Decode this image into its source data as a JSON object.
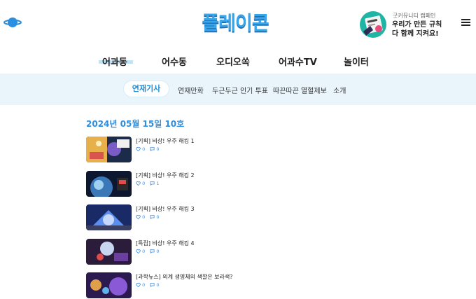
{
  "header": {
    "logo_text": "플레이콘",
    "campaign": {
      "subtitle": "굿커뮤니티 캠페인",
      "line1": "우리가 만든 규칙",
      "line2": "다 함께 지켜요!"
    }
  },
  "main_nav": {
    "items": [
      {
        "label": "어과동",
        "active": true
      },
      {
        "label": "어수동"
      },
      {
        "label": "오디오쏙"
      },
      {
        "label": "어과수TV"
      },
      {
        "label": "놀이터"
      }
    ]
  },
  "sub_nav": {
    "items": [
      {
        "label": "연재기사",
        "active": true
      },
      {
        "label": "연재만화"
      },
      {
        "label": "두근두근 인기 투표"
      },
      {
        "label": "따끈따끈 열혈제보"
      },
      {
        "label": "소개"
      }
    ]
  },
  "content": {
    "date": "2024년 05월 15일 10호",
    "articles": [
      {
        "title": "[기획] 비상! 우주 해킹 1",
        "likes": "0",
        "comments": "0"
      },
      {
        "title": "[기획] 비상! 우주 해킹 2",
        "likes": "0",
        "comments": "1"
      },
      {
        "title": "[기획] 비상! 우주 해킹 3",
        "likes": "0",
        "comments": "0"
      },
      {
        "title": "[특집] 비상! 우주 해킹 4",
        "likes": "0",
        "comments": "0"
      },
      {
        "title": "[과학뉴스] 외계 생명체의 색깔은 보라색?",
        "likes": "0",
        "comments": "0"
      }
    ]
  },
  "colors": {
    "accent": "#2b8ee0",
    "subnav_bg": "#eaf4fb",
    "logo": "#3aa6ea"
  },
  "icons": {
    "planet": "planet-icon",
    "menu": "hamburger-menu-icon",
    "like": "heart-icon",
    "comment": "comment-icon"
  }
}
